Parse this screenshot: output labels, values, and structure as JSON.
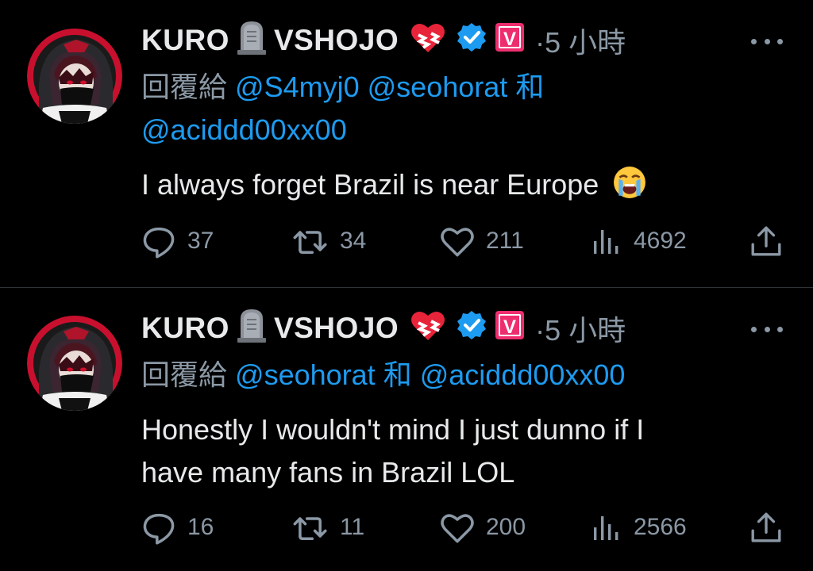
{
  "tweets": [
    {
      "display_name_part1": "KURO",
      "display_name_part2": "VSHOJO",
      "badge_letter": "V",
      "time": "·5 小時",
      "reply_prefix": "回覆給",
      "mentions_line1": [
        "@S4myj0",
        "@seohorat"
      ],
      "conjunction": "和",
      "mentions_line2": [
        "@acidd d00xx00"
      ],
      "text_lines": [
        "I always forget Brazil is near Europe"
      ],
      "replies": "37",
      "retweets": "34",
      "likes": "211",
      "views": "4692"
    },
    {
      "display_name_part1": "KURO",
      "display_name_part2": "VSHOJO",
      "badge_letter": "V",
      "time": "·5 小時",
      "reply_prefix": "回覆給",
      "mention_a": "@seohorat",
      "conjunction": "和",
      "mention_b": "@acidd d00xx00",
      "text_lines": [
        "Honestly I wouldn't mind I just dunno if I",
        "have many fans in Brazil LOL"
      ],
      "replies": "16",
      "retweets": "11",
      "likes": "200",
      "views": "2566"
    }
  ],
  "icons": {
    "headstone": "headstone-emoji",
    "heart": "mending-heart-emoji",
    "verified": "verified-badge-icon",
    "vshojo": "vshojo-badge-icon",
    "crying": "loudly-crying-emoji",
    "reply": "reply-icon",
    "retweet": "retweet-icon",
    "like": "heart-icon",
    "views": "views-icon",
    "share": "share-icon"
  },
  "colors": {
    "mention": "#1d9bf0",
    "muted": "#8b98a5",
    "text": "#e7e9ea",
    "verified": "#1d9bf0",
    "vshojo": "#ee2d6e"
  }
}
